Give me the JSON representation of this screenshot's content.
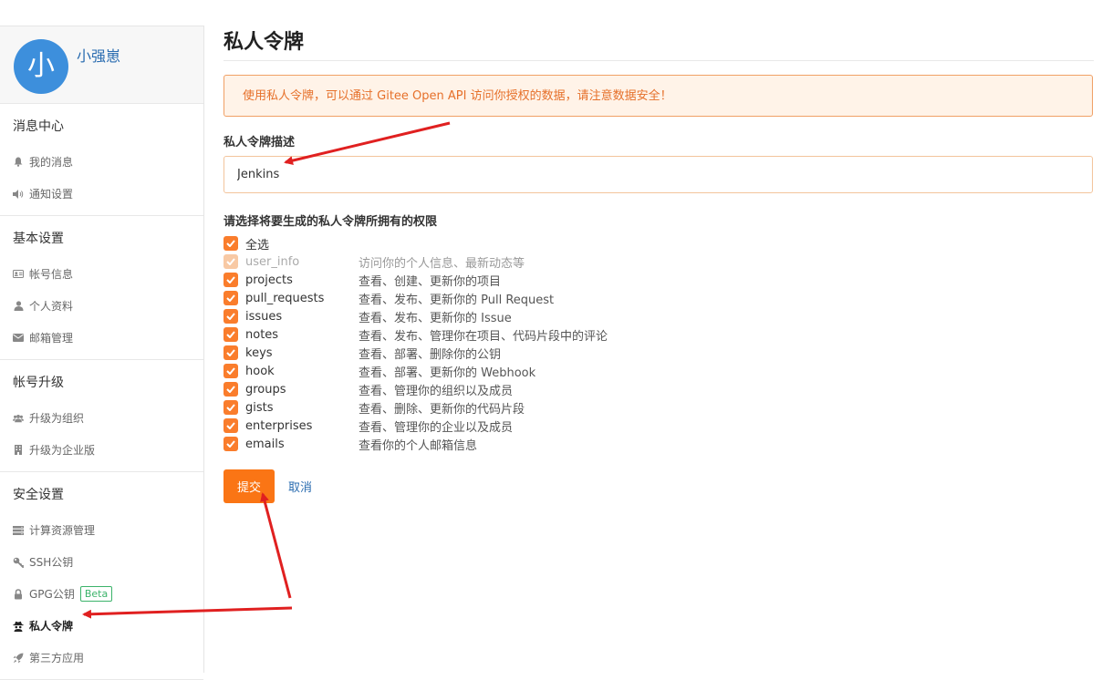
{
  "sidebar": {
    "avatar_initial": "小",
    "username": "小强崽",
    "groups": [
      {
        "title": "消息中心",
        "items": [
          {
            "label": "我的消息",
            "icon": "bell-icon"
          },
          {
            "label": "通知设置",
            "icon": "speaker-icon"
          }
        ]
      },
      {
        "title": "基本设置",
        "items": [
          {
            "label": "帐号信息",
            "icon": "id-card-icon"
          },
          {
            "label": "个人资料",
            "icon": "user-icon"
          },
          {
            "label": "邮箱管理",
            "icon": "envelope-icon"
          }
        ]
      },
      {
        "title": "帐号升级",
        "items": [
          {
            "label": "升级为组织",
            "icon": "users-icon"
          },
          {
            "label": "升级为企业版",
            "icon": "building-icon"
          }
        ]
      },
      {
        "title": "安全设置",
        "items": [
          {
            "label": "计算资源管理",
            "icon": "server-icon"
          },
          {
            "label": "SSH公钥",
            "icon": "key-icon"
          },
          {
            "label": "GPG公钥",
            "icon": "lock-icon",
            "badge": "Beta"
          },
          {
            "label": "私人令牌",
            "icon": "spy-icon",
            "active": true
          },
          {
            "label": "第三方应用",
            "icon": "rocket-icon"
          }
        ]
      }
    ]
  },
  "main": {
    "title": "私人令牌",
    "notice": "使用私人令牌，可以通过 Gitee Open API 访问你授权的数据，请注意数据安全！",
    "desc_label": "私人令牌描述",
    "desc_value": "Jenkins",
    "perm_label": "请选择将要生成的私人令牌所拥有的权限",
    "select_all": "全选",
    "scopes": [
      {
        "name": "user_info",
        "desc": "访问你的个人信息、最新动态等",
        "disabled": true
      },
      {
        "name": "projects",
        "desc": "查看、创建、更新你的项目"
      },
      {
        "name": "pull_requests",
        "desc": "查看、发布、更新你的 Pull Request"
      },
      {
        "name": "issues",
        "desc": "查看、发布、更新你的 Issue"
      },
      {
        "name": "notes",
        "desc": "查看、发布、管理你在项目、代码片段中的评论"
      },
      {
        "name": "keys",
        "desc": "查看、部署、删除你的公钥"
      },
      {
        "name": "hook",
        "desc": "查看、部署、更新你的 Webhook"
      },
      {
        "name": "groups",
        "desc": "查看、管理你的组织以及成员"
      },
      {
        "name": "gists",
        "desc": "查看、删除、更新你的代码片段"
      },
      {
        "name": "enterprises",
        "desc": "查看、管理你的企业以及成员"
      },
      {
        "name": "emails",
        "desc": "查看你的个人邮箱信息"
      }
    ],
    "submit_label": "提交",
    "cancel_label": "取消"
  },
  "colors": {
    "accent": "#fa7515",
    "notice_text": "#e6702a",
    "annotation_arrow": "#e02020",
    "link": "#2a6cb0"
  }
}
